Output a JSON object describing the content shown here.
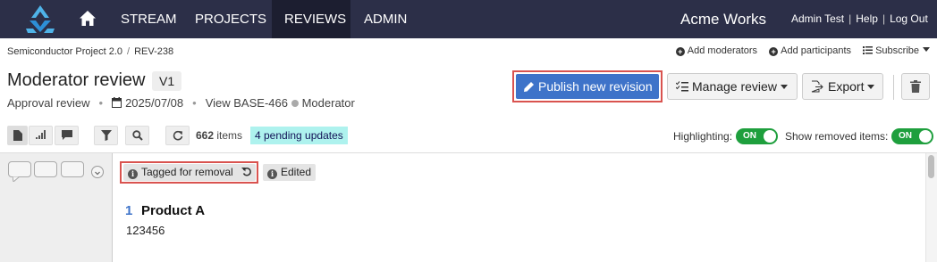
{
  "nav": {
    "items": [
      "STREAM",
      "PROJECTS",
      "REVIEWS",
      "ADMIN"
    ],
    "active": "REVIEWS",
    "brand": "Acme Works",
    "user": "Admin Test",
    "help": "Help",
    "logout": "Log Out",
    "sep": "|"
  },
  "breadcrumb": {
    "project": "Semiconductor Project 2.0",
    "sep": "/",
    "review": "REV-238"
  },
  "actions": {
    "add_moderators": "Add moderators",
    "add_participants": "Add participants",
    "subscribe": "Subscribe"
  },
  "header": {
    "title": "Moderator review",
    "version": "V1",
    "type": "Approval review",
    "bullet": "•",
    "date": "2025/07/08",
    "view": "View BASE-466",
    "role": "Moderator"
  },
  "buttons": {
    "publish": "Publish new revision",
    "manage": "Manage review",
    "export": "Export"
  },
  "toolbar": {
    "item_count": "662",
    "items_label": "items",
    "pending": "4 pending updates",
    "highlighting_label": "Highlighting:",
    "highlighting_state": "ON",
    "show_removed_label": "Show removed items:",
    "show_removed_state": "ON"
  },
  "content": {
    "tag_removal": "Tagged for removal",
    "tag_edited": "Edited",
    "item_number": "1",
    "item_title": "Product A",
    "item_value": "123456"
  },
  "colors": {
    "nav_bg": "#2c2f48",
    "primary": "#3e73c9",
    "highlight_border": "#d9534f",
    "toggle_on": "#1e9f3d",
    "pending_bg": "#aef2ee"
  }
}
